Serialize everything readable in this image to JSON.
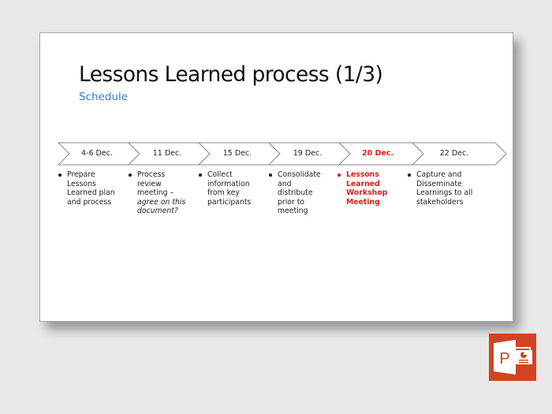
{
  "slide": {
    "title": "Lessons Learned process (1/3)",
    "subtitle": "Schedule"
  },
  "steps": [
    {
      "date": "4-6 Dec.",
      "lines": [
        "Prepare",
        "Lessons",
        "Learned plan",
        "and process"
      ],
      "highlight": false
    },
    {
      "date": "11 Dec.",
      "lines": [
        "Process",
        "review",
        "meeting –"
      ],
      "italic_lines": [
        "agree on this",
        "document?"
      ],
      "highlight": false
    },
    {
      "date": "15 Dec.",
      "lines": [
        "Collect",
        "information",
        "from key",
        "participants"
      ],
      "highlight": false
    },
    {
      "date": "19 Dec.",
      "lines": [
        "Consolidate",
        "and",
        "distribute",
        "prior to",
        "meeting"
      ],
      "highlight": false
    },
    {
      "date": "20 Dec.",
      "lines": [
        "Lessons",
        "Learned",
        "Workshop",
        "Meeting"
      ],
      "highlight": true
    },
    {
      "date": "22 Dec.",
      "lines": [
        "Capture and",
        "Disseminate",
        "Learnings to all",
        "stakeholders"
      ],
      "highlight": false
    }
  ],
  "colors": {
    "highlight": "#e31b1b",
    "subtitle": "#2e7fc9",
    "powerpoint": "#d04423",
    "background": "#e8e8e8"
  },
  "app_icon": {
    "name": "powerpoint-icon",
    "letter": "P"
  }
}
